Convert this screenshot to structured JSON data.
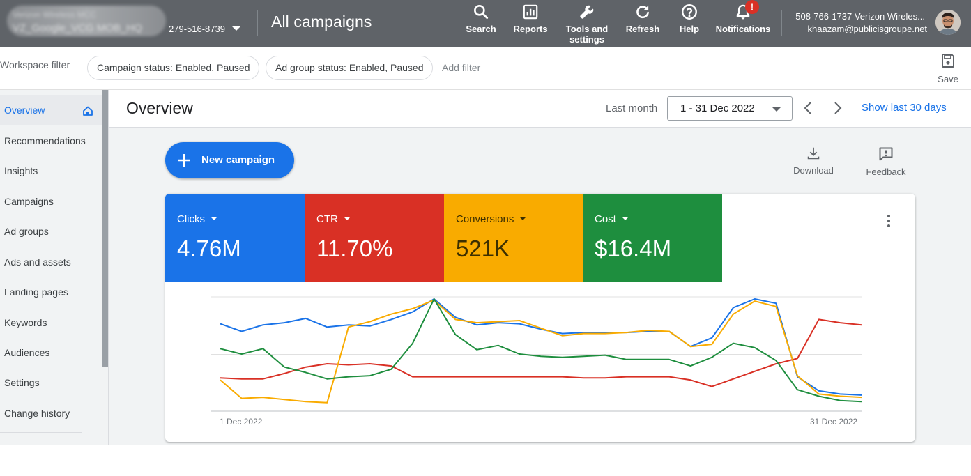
{
  "topbar": {
    "account_line1": "Verizon Wireless MCC",
    "account_line2": "VZ_Google_VCG MOB_HQ",
    "account_id": "279-516-8739",
    "page_title": "All campaigns",
    "buttons": [
      {
        "label": "Search",
        "icon": "search-icon"
      },
      {
        "label": "Reports",
        "icon": "reports-icon"
      },
      {
        "label": "Tools and",
        "label2": "settings",
        "icon": "wrench-icon"
      },
      {
        "label": "Refresh",
        "icon": "refresh-icon"
      },
      {
        "label": "Help",
        "icon": "help-icon"
      },
      {
        "label": "Notifications",
        "icon": "bell-icon"
      }
    ],
    "notification_badge": "!",
    "user_line1": "508-766-1737 Verizon Wireles...",
    "user_line2": "khaazam@publicisgroupe.net"
  },
  "filterbar": {
    "label": "Workspace filter",
    "chips": [
      "Campaign status: Enabled, Paused",
      "Ad group status: Enabled, Paused"
    ],
    "add_filter": "Add filter",
    "save_label": "Save"
  },
  "sidebar": {
    "items": [
      {
        "label": "Overview",
        "active": true
      },
      {
        "label": "Recommendations"
      },
      {
        "label": "Insights"
      },
      {
        "label": "Campaigns"
      },
      {
        "label": "Ad groups"
      },
      {
        "label": "Ads and assets"
      },
      {
        "label": "Landing pages"
      },
      {
        "label": "Keywords"
      },
      {
        "label": "Audiences"
      },
      {
        "label": "Settings"
      },
      {
        "label": "Change history"
      }
    ]
  },
  "main": {
    "title": "Overview",
    "date_range_label": "Last month",
    "date_range_value": "1 - 31 Dec 2022",
    "show_last": "Show last 30 days",
    "new_campaign": "New campaign",
    "download": "Download",
    "feedback": "Feedback"
  },
  "metrics": [
    {
      "label": "Clicks",
      "value": "4.76M",
      "color": "#1a73e8"
    },
    {
      "label": "CTR",
      "value": "11.70%",
      "color": "#d93025"
    },
    {
      "label": "Conversions",
      "value": "521K",
      "color": "#f9ab00"
    },
    {
      "label": "Cost",
      "value": "$16.4M",
      "color": "#1e8e3e"
    }
  ],
  "chart_data": {
    "type": "line",
    "x": [
      "1 Dec 2022",
      "2",
      "3",
      "4",
      "5",
      "6",
      "7",
      "8",
      "9",
      "10",
      "11",
      "12",
      "13",
      "14",
      "15",
      "16",
      "17",
      "18",
      "19",
      "20",
      "21",
      "22",
      "23",
      "24",
      "25",
      "26",
      "27",
      "28",
      "29",
      "30",
      "31 Dec 2022"
    ],
    "x_tick_labels": [
      "1 Dec 2022",
      "31 Dec 2022"
    ],
    "grid": true,
    "series": [
      {
        "name": "Clicks",
        "color": "#1a73e8",
        "values": [
          0.77,
          0.7,
          0.76,
          0.78,
          0.82,
          0.74,
          0.76,
          0.75,
          0.81,
          0.88,
          1.0,
          0.83,
          0.76,
          0.78,
          0.77,
          0.72,
          0.68,
          0.69,
          0.69,
          0.69,
          0.7,
          0.7,
          0.56,
          0.64,
          0.92,
          1.0,
          0.96,
          0.28,
          0.15,
          0.12,
          0.11
        ]
      },
      {
        "name": "CTR",
        "color": "#d93025",
        "values": [
          0.27,
          0.26,
          0.26,
          0.31,
          0.37,
          0.4,
          0.39,
          0.4,
          0.38,
          0.28,
          0.28,
          0.28,
          0.28,
          0.28,
          0.28,
          0.28,
          0.28,
          0.27,
          0.27,
          0.28,
          0.28,
          0.28,
          0.25,
          0.19,
          0.26,
          0.33,
          0.4,
          0.45,
          0.81,
          0.78,
          0.76
        ]
      },
      {
        "name": "Conversions",
        "color": "#f9ab00",
        "values": [
          0.25,
          0.08,
          0.09,
          0.07,
          0.05,
          0.04,
          0.74,
          0.79,
          0.86,
          0.91,
          0.99,
          0.81,
          0.78,
          0.79,
          0.8,
          0.73,
          0.66,
          0.68,
          0.68,
          0.69,
          0.71,
          0.7,
          0.56,
          0.58,
          0.86,
          0.98,
          0.93,
          0.29,
          0.12,
          0.1,
          0.09
        ]
      },
      {
        "name": "Cost",
        "color": "#1e8e3e",
        "values": [
          0.54,
          0.49,
          0.54,
          0.37,
          0.32,
          0.26,
          0.28,
          0.29,
          0.35,
          0.59,
          1.0,
          0.67,
          0.53,
          0.57,
          0.49,
          0.47,
          0.46,
          0.47,
          0.48,
          0.44,
          0.44,
          0.44,
          0.38,
          0.46,
          0.59,
          0.55,
          0.43,
          0.16,
          0.1,
          0.06,
          0.05
        ]
      }
    ]
  }
}
